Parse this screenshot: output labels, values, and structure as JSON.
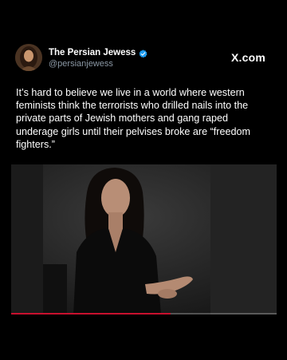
{
  "post": {
    "author": {
      "display_name": "The Persian Jewess",
      "handle": "@persianjewess",
      "verified": true,
      "avatar_icon": "profile-avatar-icon"
    },
    "brand_label": "X.com",
    "text": "It’s hard to believe we live in a world where western feminists think the terrorists who drilled nails into the private parts of Jewish mothers and gang raped underage girls until their pelvises broke are “freedom fighters.”"
  },
  "video": {
    "progress": 0.6,
    "progress_color": "#c8102e"
  },
  "colors": {
    "background": "#000000",
    "text": "#ffffff",
    "handle": "#8b98a5",
    "verified": "#1d9bf0"
  }
}
